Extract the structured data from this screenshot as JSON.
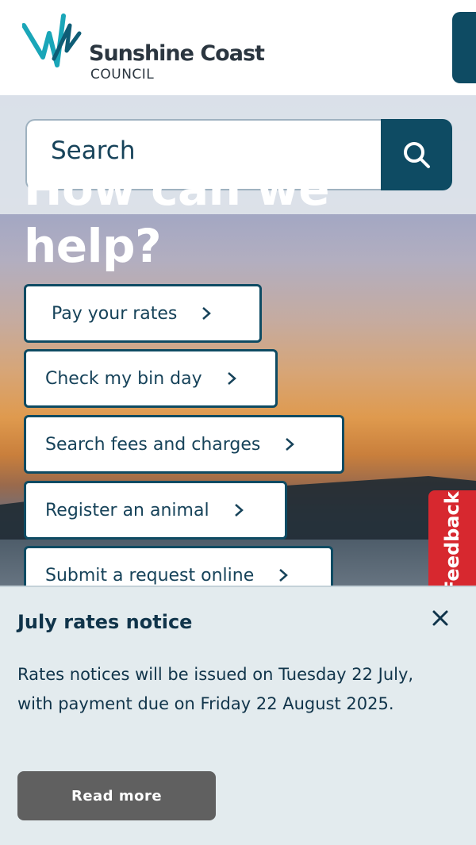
{
  "header": {
    "logo_title": "Sunshine Coast",
    "logo_subtitle": "COUNCIL"
  },
  "search": {
    "placeholder": "Search"
  },
  "hero": {
    "heading": "How can we help?"
  },
  "quick_links": [
    {
      "label": "Pay your rates"
    },
    {
      "label": "Check my bin day"
    },
    {
      "label": "Search fees and charges"
    },
    {
      "label": "Register an animal"
    },
    {
      "label": "Submit a request online"
    }
  ],
  "feedback": {
    "label": "Feedback"
  },
  "notice": {
    "title": "July rates notice",
    "body": " Rates notices will be issued on Tuesday 22 July, with payment due on Friday 22 August 2025.",
    "button_label": "Read more"
  },
  "colors": {
    "brand": "#0e4b63",
    "feedback": "#d7282f",
    "notice_bg": "#e3ebee",
    "button_gray": "#606060"
  }
}
